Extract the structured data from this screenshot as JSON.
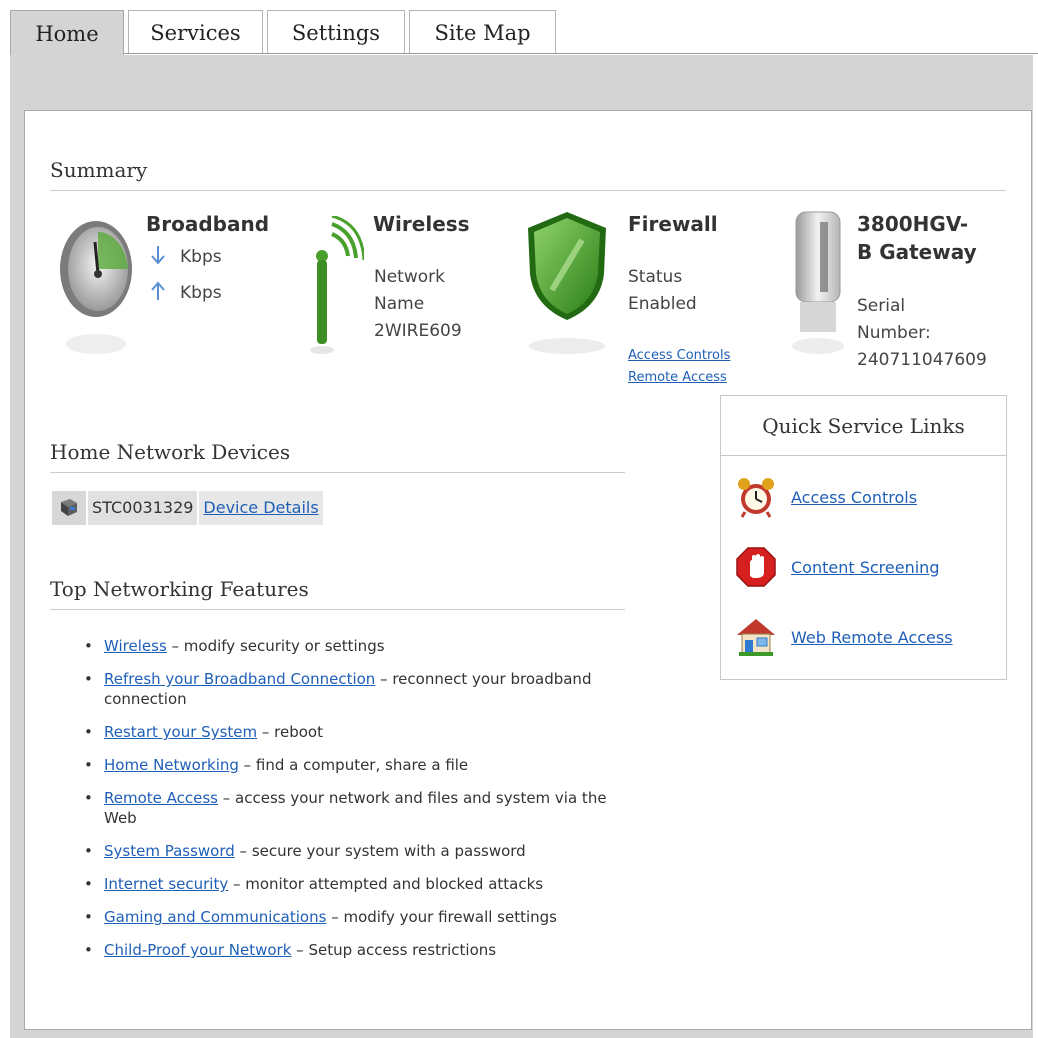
{
  "tabs": [
    {
      "label": "Home",
      "active": true
    },
    {
      "label": "Services",
      "active": false
    },
    {
      "label": "Settings",
      "active": false
    },
    {
      "label": "Site Map",
      "active": false
    }
  ],
  "summary": {
    "title": "Summary",
    "broadband": {
      "title": "Broadband",
      "down": "Kbps",
      "up": "Kbps"
    },
    "wireless": {
      "title": "Wireless",
      "line1": "Network",
      "line2": "Name",
      "line3": "2WIRE609"
    },
    "firewall": {
      "title": "Firewall",
      "line1": "Status",
      "line2": "Enabled",
      "link1": "Access Controls",
      "link2": "Remote Access"
    },
    "gateway": {
      "title1": "3800HGV-",
      "title2": "B Gateway",
      "line1": "Serial",
      "line2": "Number:",
      "line3": "240711047609"
    }
  },
  "home_network": {
    "title": "Home Network Devices",
    "device_name": "STC0031329",
    "details_link": "Device Details"
  },
  "top_features": {
    "title": "Top Networking Features",
    "items": [
      {
        "link": "Wireless",
        "text": " – modify security or settings"
      },
      {
        "link": "Refresh your Broadband Connection",
        "text": " – reconnect your broadband connection"
      },
      {
        "link": "Restart your System",
        "text": " – reboot"
      },
      {
        "link": "Home Networking",
        "text": " – find a computer, share a file"
      },
      {
        "link": "Remote Access",
        "text": " – access your network and files and system via the Web"
      },
      {
        "link": "System Password",
        "text": " – secure your system with a password"
      },
      {
        "link": "Internet security",
        "text": " – monitor attempted and blocked attacks"
      },
      {
        "link": "Gaming and Communications",
        "text": " – modify your firewall settings"
      },
      {
        "link": "Child-Proof your Network",
        "text": " – Setup access restrictions"
      }
    ]
  },
  "quick_links": {
    "title": "Quick Service Links",
    "items": [
      {
        "label": "Access Controls",
        "icon": "alarm-clock-icon"
      },
      {
        "label": "Content Screening",
        "icon": "stop-hand-icon"
      },
      {
        "label": "Web Remote Access",
        "icon": "house-icon"
      }
    ]
  },
  "colors": {
    "link": "#1f5fb8",
    "firewall_green": "#3a9a24",
    "tab_active": "#d4d4d4"
  }
}
